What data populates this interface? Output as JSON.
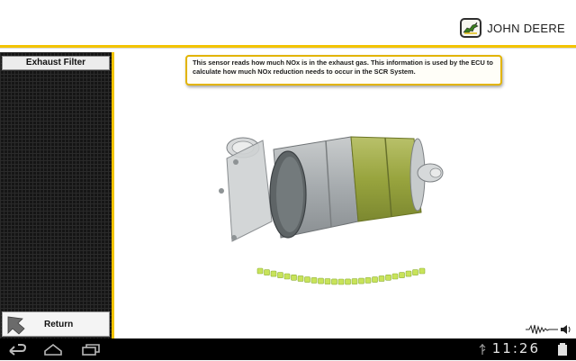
{
  "header": {
    "brand_name": "JOHN DEERE"
  },
  "sidebar": {
    "title": "Exhaust Filter",
    "return_label": "Return"
  },
  "callout": {
    "text": "This sensor reads how much NOx is in the exhaust gas. This information is used by the ECU to calculate how much NOx reduction needs to occur in the SCR System."
  },
  "status_bar": {
    "time": "11:26"
  },
  "colors": {
    "accent_yellow": "#f3c400",
    "progress_green": "#c8e35a",
    "sidebar_dark": "#151515"
  },
  "icons": {
    "brand": "deer-logo-icon",
    "return": "back-arrow-icon",
    "audio": "audio-wave-icon",
    "nav_back": "back-icon",
    "nav_home": "home-icon",
    "nav_recent": "recent-apps-icon"
  }
}
